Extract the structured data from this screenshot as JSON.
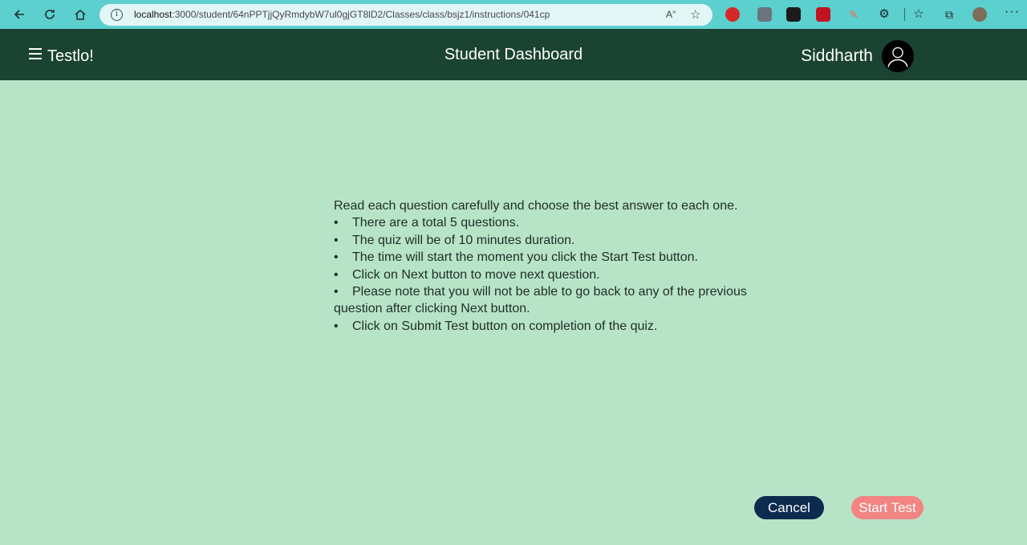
{
  "browser": {
    "url_host": "localhost",
    "url_path": ":3000/student/64nPPTjjQyRmdybW7ul0gjGT8lD2/Classes/class/bsjz1/instructions/041cp"
  },
  "header": {
    "brand": "Testlo!",
    "title": "Student Dashboard",
    "user_name": "Siddharth"
  },
  "instructions": {
    "intro": "Read each question carefully and choose the best answer to each one.",
    "items": [
      "There are a total 5 questions.",
      "The quiz will be of 10 minutes duration.",
      "The time will start the moment you click the Start Test button.",
      "Click on Next button to move next question.",
      "Please note that you will not be able to go back to any of the previous",
      "question after clicking Next button.",
      "Click on Submit Test button on completion of the quiz."
    ],
    "bullet": "•"
  },
  "actions": {
    "cancel_label": "Cancel",
    "start_label": "Start Test"
  },
  "colors": {
    "page_bg": "#b7e4c7",
    "header_bg": "#1b4332",
    "cancel_bg": "#0d2a4f",
    "start_bg": "#f28482"
  }
}
